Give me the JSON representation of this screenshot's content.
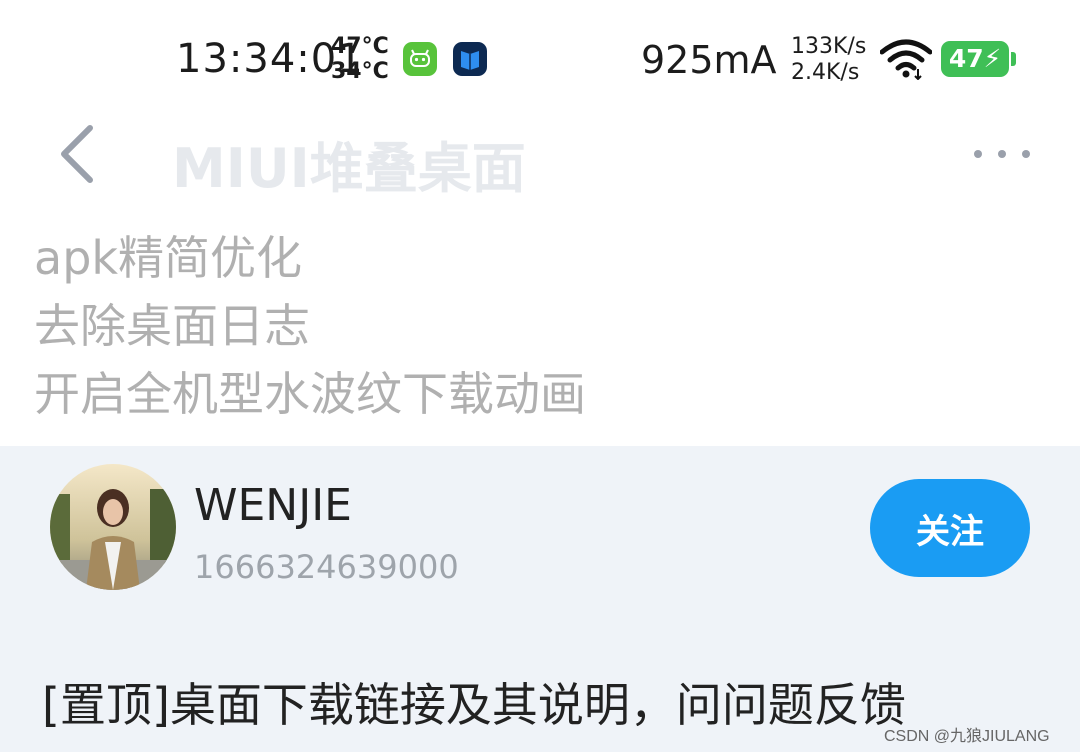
{
  "status_bar": {
    "time": "13:34:01",
    "temp_cpu": "47°C",
    "temp_battery": "34°C",
    "current": "925mA",
    "upload_speed": "133K/s",
    "download_speed": "2.4K/s",
    "battery_level": "47",
    "app_icons": [
      "android-robot-icon",
      "book-app-icon"
    ]
  },
  "header": {
    "title": "MIUI堆叠桌面",
    "back_icon": "chevron-left-icon",
    "more_icon": "more-dots-icon"
  },
  "description": {
    "lines": [
      "apk精简优化",
      "去除桌面日志",
      "开启全机型水波纹下载动画"
    ]
  },
  "post": {
    "username": "WENJIE",
    "timestamp": "1666324639000",
    "follow_label": "关注",
    "content": "[置顶]桌面下载链接及其说明，问问题反馈",
    "accent_color": "#1a9cf3"
  },
  "watermark": "CSDN @九狼JIULANG"
}
